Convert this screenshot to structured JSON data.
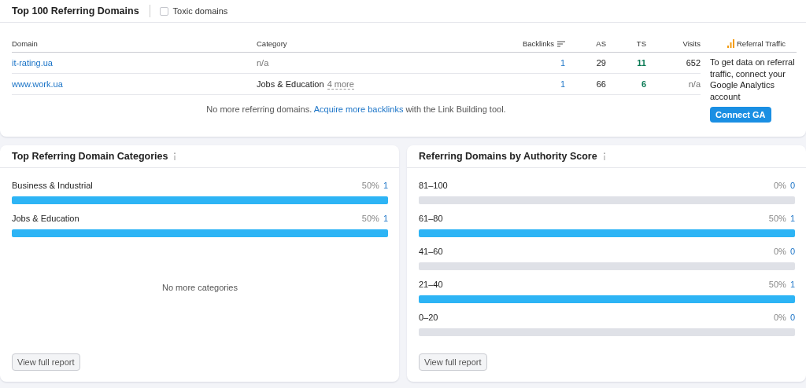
{
  "header": {
    "title": "Top 100 Referring Domains",
    "toxic_filter": {
      "label": "Toxic domains",
      "checked": false
    }
  },
  "table": {
    "columns": [
      "Domain",
      "Category",
      "Backlinks",
      "AS",
      "TS",
      "Visits"
    ],
    "rows": [
      {
        "domain": "it-rating.ua",
        "category": "n/a",
        "category_muted": true,
        "backlinks": "1",
        "as": "29",
        "ts": "11",
        "visits": "652",
        "visits_muted": false
      },
      {
        "domain": "www.work.ua",
        "category": "Jobs & Education",
        "category_muted": false,
        "more": "4 more",
        "backlinks": "1",
        "as": "66",
        "ts": "6",
        "visits": "n/a",
        "visits_muted": true
      }
    ],
    "footer": {
      "before": "No more referring domains. ",
      "link": "Acquire more backlinks",
      "after": " with the Link Building tool."
    }
  },
  "referral": {
    "header": "Referral Traffic",
    "message": "To get data on referral traffic, connect your Google Analytics account",
    "button": "Connect GA"
  },
  "panels": [
    {
      "title": "Top Referring Domain Categories",
      "rows": [
        {
          "label": "Business & Industrial",
          "percent": "50%",
          "count": "1",
          "level": 1
        },
        {
          "label": "Jobs & Education",
          "percent": "50%",
          "count": "1",
          "level": 1
        }
      ],
      "empty_message": "No more categories",
      "button": "View full report"
    },
    {
      "title": "Referring Domains by Authority Score",
      "rows": [
        {
          "label": "81–100",
          "percent": "0%",
          "count": "0",
          "level": 0
        },
        {
          "label": "61–80",
          "percent": "50%",
          "count": "1",
          "level": 1
        },
        {
          "label": "41–60",
          "percent": "0%",
          "count": "0",
          "level": 0
        },
        {
          "label": "21–40",
          "percent": "50%",
          "count": "1",
          "level": 1
        },
        {
          "label": "0–20",
          "percent": "0%",
          "count": "0",
          "level": 0
        }
      ],
      "button": "View full report"
    }
  ]
}
